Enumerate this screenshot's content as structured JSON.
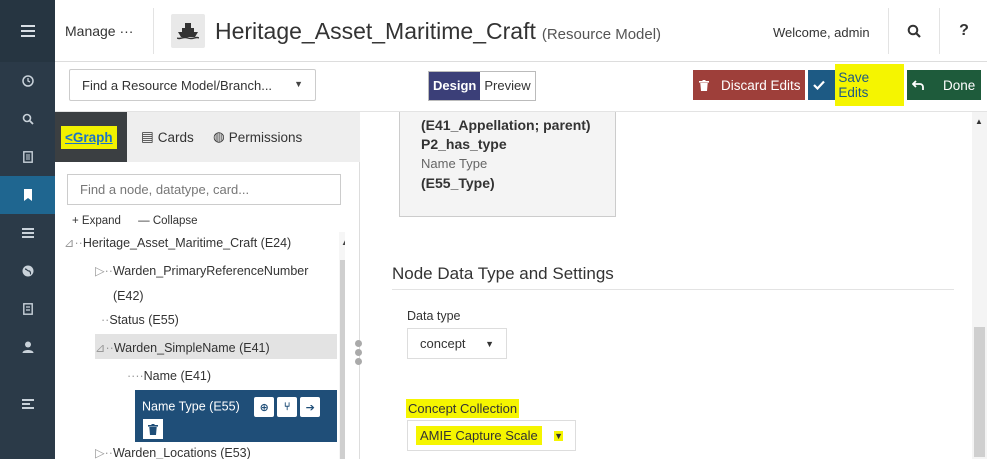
{
  "rail": {
    "items": [
      {
        "icon": "menu-icon"
      },
      {
        "icon": "clock-icon"
      },
      {
        "icon": "search-icon"
      },
      {
        "icon": "document-icon"
      },
      {
        "icon": "bookmark-icon"
      },
      {
        "icon": "list-icon"
      },
      {
        "icon": "globe-icon"
      },
      {
        "icon": "file-icon"
      },
      {
        "icon": "user-icon"
      },
      {
        "icon": "align-icon"
      }
    ]
  },
  "header": {
    "manage": "Manage ···",
    "title": "Heritage_Asset_Maritime_Craft",
    "subtitle": "(Resource Model)",
    "welcome": "Welcome, admin",
    "search_glyph": "🔍",
    "help_glyph": "?"
  },
  "toolbar": {
    "finder": "Find a Resource Model/Branch...",
    "design": "Design",
    "preview": "Preview",
    "discard": "Discard Edits",
    "save": "Save Edits",
    "done": "Done"
  },
  "panel": {
    "tabs": {
      "graph": "Graph",
      "cards": "Cards",
      "permissions": "Permissions"
    },
    "search_placeholder": "Find a node, datatype, card...",
    "expand": "+ Expand",
    "collapse": "— Collapse",
    "tree": [
      "Heritage_Asset_Maritime_Craft (E24)",
      "Warden_PrimaryReferenceNumber",
      "(E42)",
      "Status (E55)",
      "Warden_SimpleName (E41)",
      "Name (E41)",
      "Name Type (E55)",
      "Warden_Locations (E53)"
    ]
  },
  "card": {
    "line1": "(E41_Appellation; parent)",
    "line2": "P2_has_type",
    "line3": "Name Type",
    "line4": "(E55_Type)"
  },
  "settings": {
    "title": "Node Data Type and Settings",
    "datatype_label": "Data type",
    "datatype_value": "concept",
    "collection_label": "Concept Collection",
    "collection_value": "AMIE Capture Scale"
  },
  "colors": {
    "rail": "#2b3a48",
    "accent": "#1f6690",
    "highlight": "#f5f500",
    "discard": "#9e3f3a",
    "save": "#1d5a84",
    "done": "#1e5b3b",
    "active_node": "#1f4e78"
  }
}
